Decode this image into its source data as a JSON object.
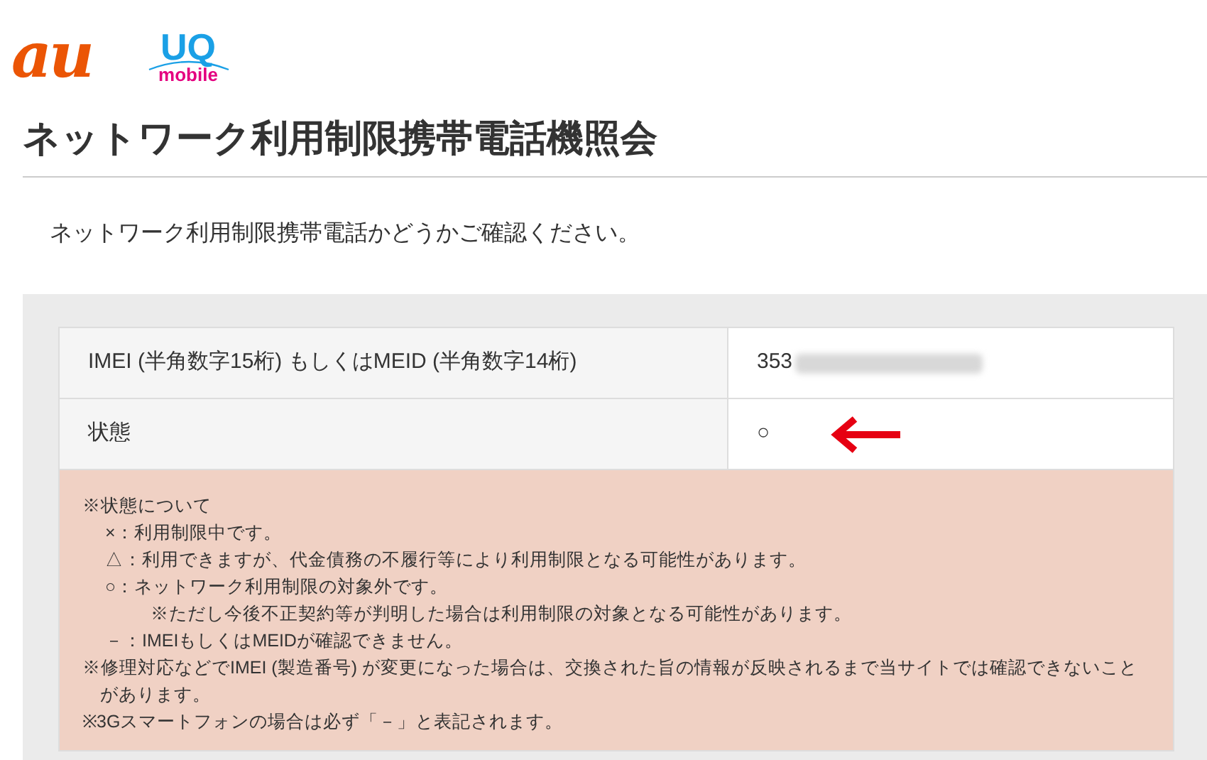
{
  "logos": {
    "au": "au",
    "uq": "UQ",
    "uq_sub": "mobile"
  },
  "title": "ネットワーク利用制限携帯電話機照会",
  "lead": "ネットワーク利用制限携帯電話かどうかご確認ください。",
  "table": {
    "rows": [
      {
        "label": "IMEI (半角数字15桁) もしくはMEID (半角数字14桁)",
        "value": "353",
        "kind": "redacted"
      },
      {
        "label": "状態",
        "value": "○",
        "kind": "status"
      }
    ]
  },
  "notes": [
    {
      "text": "※状態について",
      "children": [
        {
          "text": "×：利用制限中です。"
        },
        {
          "text": "△：利用できますが、代金債務の不履行等により利用制限となる可能性があります。"
        },
        {
          "text": "○：ネットワーク利用制限の対象外です。",
          "children": [
            {
              "text": "※ただし今後不正契約等が判明した場合は利用制限の対象となる可能性があります。"
            }
          ]
        },
        {
          "text": "－：IMEIもしくはMEIDが確認できません。"
        }
      ]
    },
    {
      "text": "※修理対応などでIMEI (製造番号) が変更になった場合は、交換された旨の情報が反映されるまで当サイトでは確認できないことがあります。"
    },
    {
      "text": "※3Gスマートフォンの場合は必ず「－」と表記されます。"
    }
  ]
}
